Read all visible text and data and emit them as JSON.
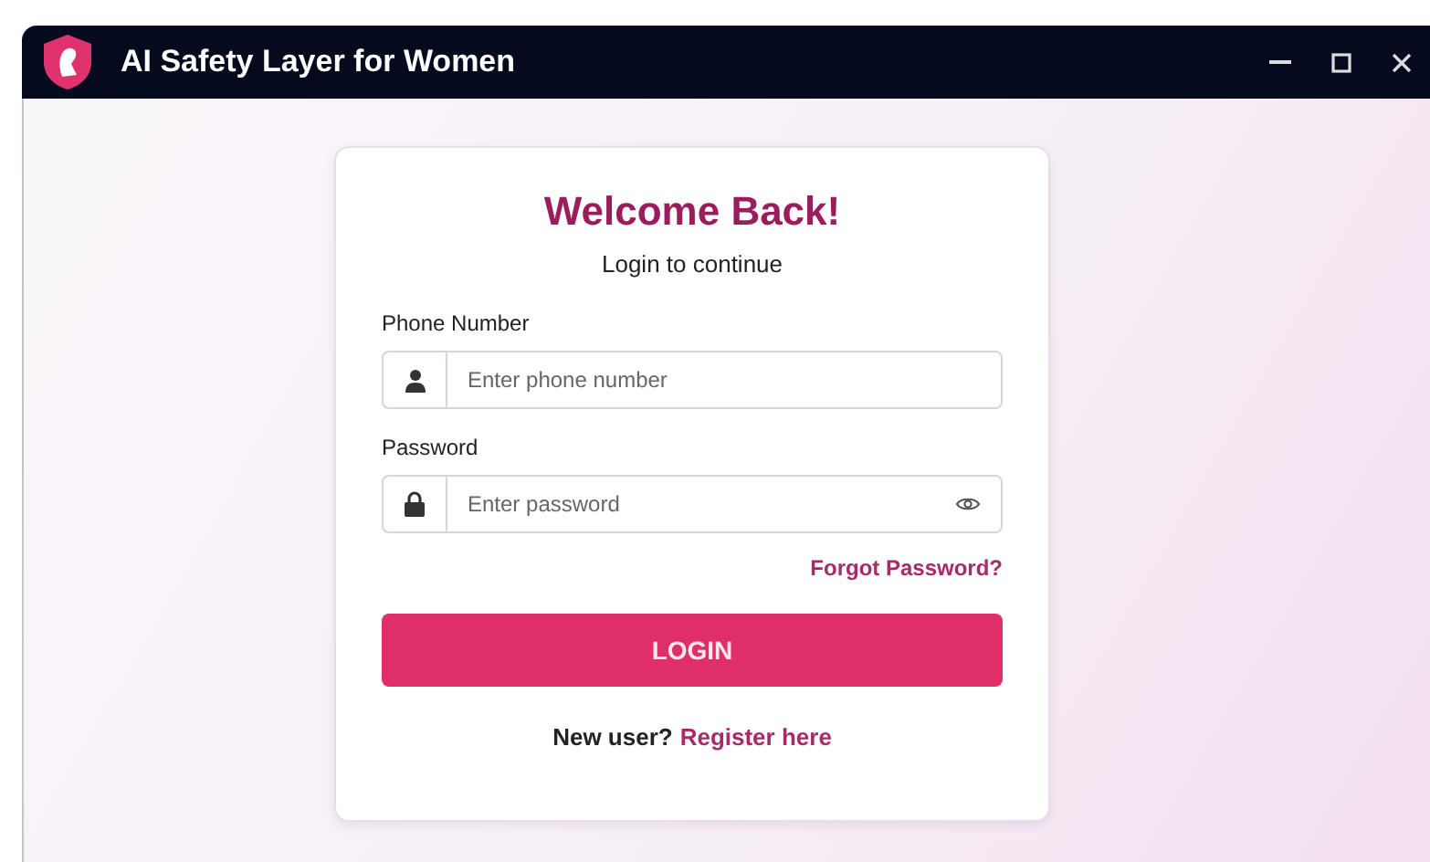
{
  "window": {
    "title": "AI Safety Layer for Women"
  },
  "card": {
    "heading": "Welcome Back!",
    "subheading": "Login to continue",
    "fields": [
      {
        "kind": "phone",
        "label": "Phone Number",
        "placeholder": "Enter phone number"
      },
      {
        "kind": "password",
        "label": "Password",
        "placeholder": "Enter password"
      }
    ],
    "forgot_link": "Forgot Password?",
    "login_button": "LOGIN",
    "register_prompt": "New user?",
    "register_link": "Register here"
  }
}
